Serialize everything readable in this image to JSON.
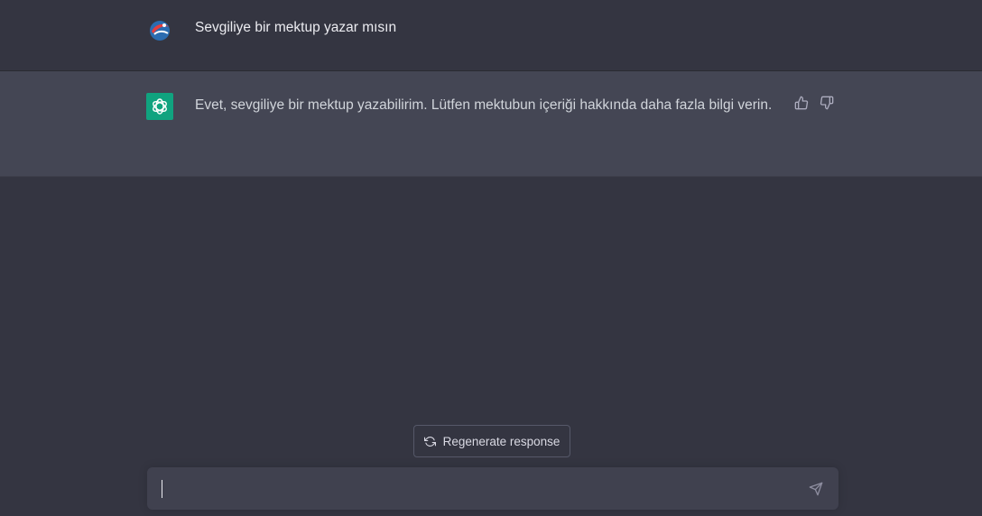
{
  "conversation": {
    "user_message": "Sevgiliye bir mektup yazar mısın",
    "assistant_message": "Evet, sevgiliye bir mektup yazabilirim. Lütfen mektubun içeriği hakkında daha fazla bilgi verin."
  },
  "actions": {
    "regenerate_label": "Regenerate response"
  },
  "composer": {
    "value": ""
  },
  "icons": {
    "user_avatar": "user-avatar-icon",
    "bot_avatar": "openai-logo-icon",
    "thumb_up": "thumbs-up-icon",
    "thumb_down": "thumbs-down-icon",
    "regenerate": "refresh-icon",
    "send": "send-icon"
  },
  "colors": {
    "background": "#343541",
    "assistant_row": "#444654",
    "bot_avatar": "#10a37f",
    "composer": "#40414f"
  }
}
